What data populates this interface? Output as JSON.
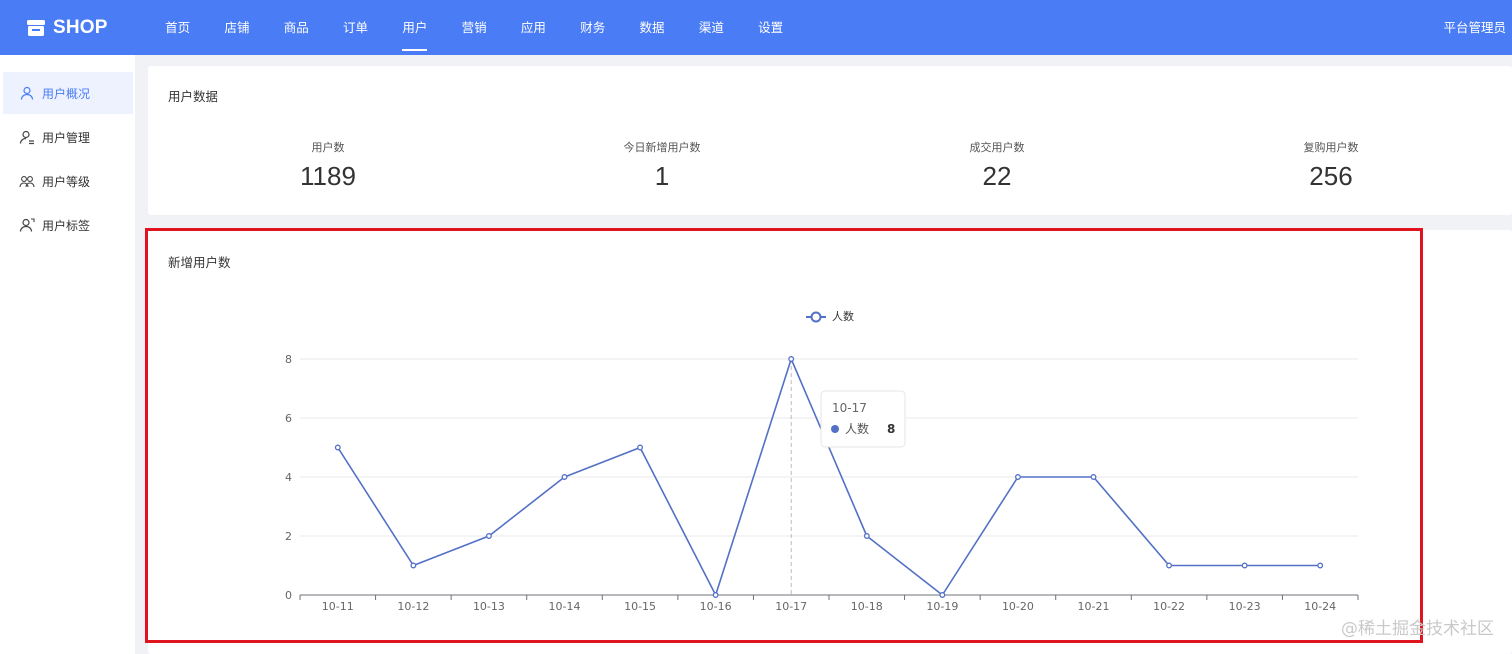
{
  "brand": {
    "name": "SHOP"
  },
  "nav": {
    "items": [
      "首页",
      "店铺",
      "商品",
      "订单",
      "用户",
      "营销",
      "应用",
      "财务",
      "数据",
      "渠道",
      "设置"
    ],
    "active_index": 4
  },
  "user": {
    "name": "平台管理员"
  },
  "sidebar": {
    "items": [
      {
        "label": "用户概况",
        "icon": "user-icon",
        "active": true
      },
      {
        "label": "用户管理",
        "icon": "user-manage-icon",
        "active": false
      },
      {
        "label": "用户等级",
        "icon": "users-group-icon",
        "active": false
      },
      {
        "label": "用户标签",
        "icon": "user-tag-icon",
        "active": false
      }
    ]
  },
  "stats": {
    "title": "用户数据",
    "items": [
      {
        "label": "用户数",
        "value": "1189"
      },
      {
        "label": "今日新增用户数",
        "value": "1"
      },
      {
        "label": "成交用户数",
        "value": "22"
      },
      {
        "label": "复购用户数",
        "value": "256"
      }
    ]
  },
  "chart": {
    "title": "新增用户数",
    "tooltip": {
      "date": "10-17",
      "series": "人数",
      "value": "8"
    }
  },
  "chart_data": {
    "type": "line",
    "title": "新增用户数",
    "xlabel": "",
    "ylabel": "",
    "categories": [
      "10-11",
      "10-12",
      "10-13",
      "10-14",
      "10-15",
      "10-16",
      "10-17",
      "10-18",
      "10-19",
      "10-20",
      "10-21",
      "10-22",
      "10-23",
      "10-24"
    ],
    "series": [
      {
        "name": "人数",
        "values": [
          5,
          1,
          2,
          4,
          5,
          0,
          8,
          2,
          0,
          4,
          4,
          1,
          1,
          1
        ]
      }
    ],
    "ylim": [
      0,
      8
    ],
    "yticks": [
      0,
      2,
      4,
      6,
      8
    ],
    "legend": "top-center",
    "grid": true,
    "color": "#5470c6"
  },
  "colors": {
    "primary": "#4a7cf6",
    "series": "#5470c6",
    "highlight": "#e0141e"
  },
  "watermark": "@稀土掘金技术社区"
}
